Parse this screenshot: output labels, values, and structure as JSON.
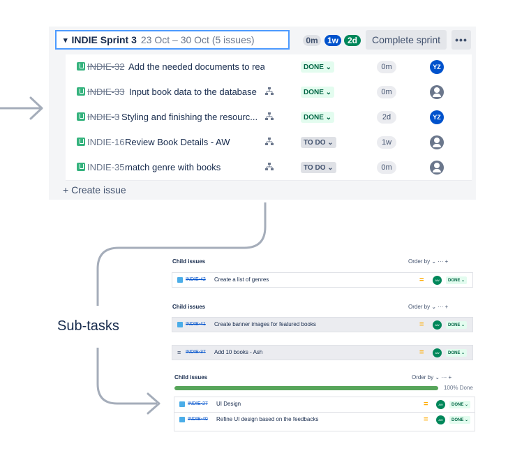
{
  "sprint": {
    "chevron": "▾",
    "name": "INDIE Sprint 3",
    "dates": "23 Oct – 30 Oct (5 issues)",
    "estimates": {
      "todo": "0m",
      "in_progress": "1w",
      "done": "2d"
    },
    "complete_label": "Complete sprint",
    "more_label": "•••",
    "issues": [
      {
        "key": "INDIE-32",
        "summary": "Add the needed documents to rea...",
        "status": "DONE ⌄",
        "estimate": "0m",
        "assignee": "YZ",
        "done": true
      },
      {
        "key": "INDIE-33",
        "summary": "Input book data to the database",
        "status": "DONE ⌄",
        "estimate": "0m",
        "assignee": "",
        "done": true
      },
      {
        "key": "INDIE-3",
        "summary": "Styling and finishing the resourc...",
        "status": "DONE ⌄",
        "estimate": "2d",
        "assignee": "YZ",
        "done": true
      },
      {
        "key": "INDIE-16",
        "summary": "Review Book Details - AW",
        "status": "TO DO ⌄",
        "estimate": "1w",
        "assignee": "",
        "done": false
      },
      {
        "key": "INDIE-35",
        "summary": "match genre with books",
        "status": "TO DO ⌄",
        "estimate": "0m",
        "assignee": "",
        "done": false
      }
    ],
    "create_issue_label": "+ Create issue"
  },
  "subtasks_label": "Sub-tasks",
  "child_panels": [
    {
      "title": "Child issues",
      "order_by": "Order by  ⌄    ···   +",
      "rows": [
        {
          "key": "INDIE-42",
          "summary": "Create a list of genres",
          "priority": "=",
          "avatar": "AW",
          "status": "DONE ⌄"
        }
      ]
    },
    {
      "title": "Child issues",
      "order_by": "Order by  ⌄    ···   +",
      "rows": [
        {
          "key": "INDIE-41",
          "summary": "Create banner images for featured books",
          "priority": "=",
          "avatar": "AW",
          "status": "DONE ⌄"
        },
        {
          "key": "INDIE-37",
          "summary": "Add 10 books - Ash",
          "priority": "=",
          "avatar": "AW",
          "status": "DONE ⌄"
        }
      ]
    },
    {
      "title": "Child issues",
      "order_by": "Order by  ⌄    ···   +",
      "progress": 1.0,
      "progress_label": "100% Done",
      "rows": [
        {
          "key": "INDIE-27",
          "summary": "UI Design",
          "priority": "=",
          "avatar": "AW",
          "status": "DONE ⌄"
        },
        {
          "key": "INDIE-40",
          "summary": "Refine UI design based on the feedbacks",
          "priority": "=",
          "avatar": "AW",
          "status": "DONE ⌄"
        }
      ]
    }
  ],
  "colors": {
    "accent": "#0052cc",
    "done_green": "#00875a",
    "story_green": "#36b37e",
    "connector_grey": "#a5adba",
    "focus_blue": "#4c9aff"
  }
}
